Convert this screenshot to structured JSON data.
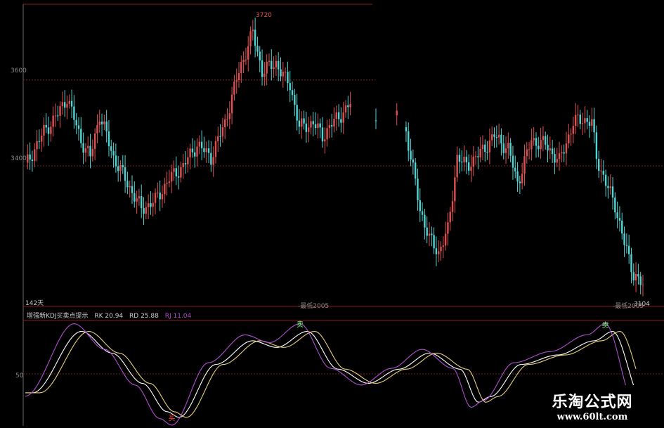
{
  "chart_data": [
    {
      "type": "candlestick",
      "y_ticks": [
        3400,
        3600
      ],
      "ylim": [
        3090,
        3740
      ],
      "annotations": {
        "high": "3720",
        "low": "3104",
        "bars": "142天",
        "mid": "-最低2005",
        "right": "-最低2005"
      },
      "colors": {
        "up": "#e05050",
        "down": "#4fd6d6",
        "grid": "#7a1f1f",
        "frame": "#8a1a1a"
      }
    },
    {
      "type": "line",
      "title_parts": {
        "name": "增强新KDJ买卖点提示",
        "rk": "RK 20.94",
        "rd": "RD 25.88",
        "rj": "RJ 11.04"
      },
      "y_ticks": [
        50
      ],
      "ylim": [
        -5,
        105
      ],
      "series": [
        {
          "name": "RK",
          "color": "#ffffff"
        },
        {
          "name": "RD",
          "color": "#e6d07a"
        },
        {
          "name": "RJ",
          "color": "#b04fd0"
        }
      ],
      "signals": [
        {
          "type": "sell",
          "label": "卖",
          "index": 0.45
        },
        {
          "type": "sell",
          "label": "卖",
          "index": 0.95
        },
        {
          "type": "buy",
          "label": "买",
          "index": 0.24
        }
      ]
    }
  ],
  "watermark": {
    "line1": "乐淘公式网",
    "line2": "www.60lt.com"
  }
}
